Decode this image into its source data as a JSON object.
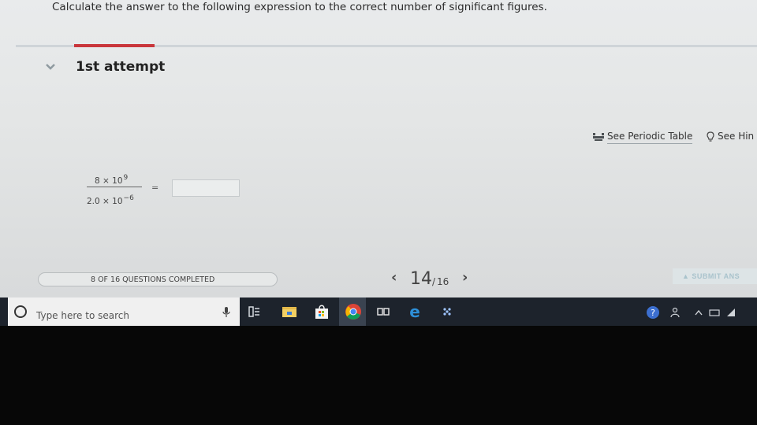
{
  "question": {
    "prompt": "Calculate the answer to the following expression to the correct number of significant figures."
  },
  "attempt": {
    "label": "1st attempt"
  },
  "tools": {
    "periodic_table": "See Periodic Table",
    "hint": "See Hin"
  },
  "expression": {
    "numerator_coef": "8 × 10",
    "numerator_exp": "9",
    "denominator_coef": "2.0  ×  10",
    "denominator_exp": "−6",
    "equals": "="
  },
  "answer_input": {
    "value": ""
  },
  "progress": {
    "label": "8 OF 16 QUESTIONS COMPLETED",
    "completed": 8,
    "total": 16
  },
  "pager": {
    "current": "14",
    "separator": "/",
    "total": "16"
  },
  "submit": {
    "label": "SUBMIT ANS"
  },
  "taskbar": {
    "search_placeholder": "Type here to search",
    "pinned_apps": [
      "task-view-icon",
      "file-explorer-icon",
      "store-icon",
      "chrome-icon",
      "media-icon",
      "edge-icon",
      "dropbox-icon"
    ]
  },
  "colors": {
    "accent_red": "#c9363b",
    "taskbar": "#1d232c",
    "page_bg": "#e6e8e9"
  }
}
